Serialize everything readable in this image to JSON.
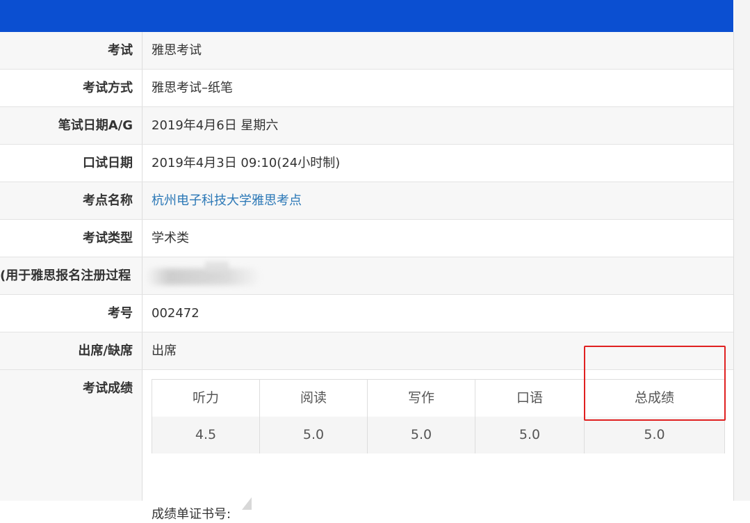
{
  "rows": [
    {
      "label": "考试",
      "value": "雅思考试"
    },
    {
      "label": "考试方式",
      "value": "雅思考试–纸笔"
    },
    {
      "label": "笔试日期A/G",
      "value": "2019年4月6日 星期六"
    },
    {
      "label": "口试日期",
      "value": "2019年4月3日 09:10(24小时制)"
    },
    {
      "label": "考点名称",
      "value": "杭州电子科技大学雅思考点"
    },
    {
      "label": "考试类型",
      "value": "学术类"
    },
    {
      "label": "用于雅思报名注册过程)",
      "value": ""
    },
    {
      "label": "考号",
      "value": "002472"
    },
    {
      "label": "出席/缺席",
      "value": "出席"
    }
  ],
  "scores": {
    "label": "考试成绩",
    "headers": [
      "听力",
      "阅读",
      "写作",
      "口语",
      "总成绩"
    ],
    "values": [
      "4.5",
      "5.0",
      "5.0",
      "5.0",
      "5.0"
    ],
    "certificate_label": "成绩单证书号:"
  },
  "colors": {
    "header_bar": "#0b4fd1",
    "link": "#2a77b6",
    "highlight": "#e02020"
  }
}
